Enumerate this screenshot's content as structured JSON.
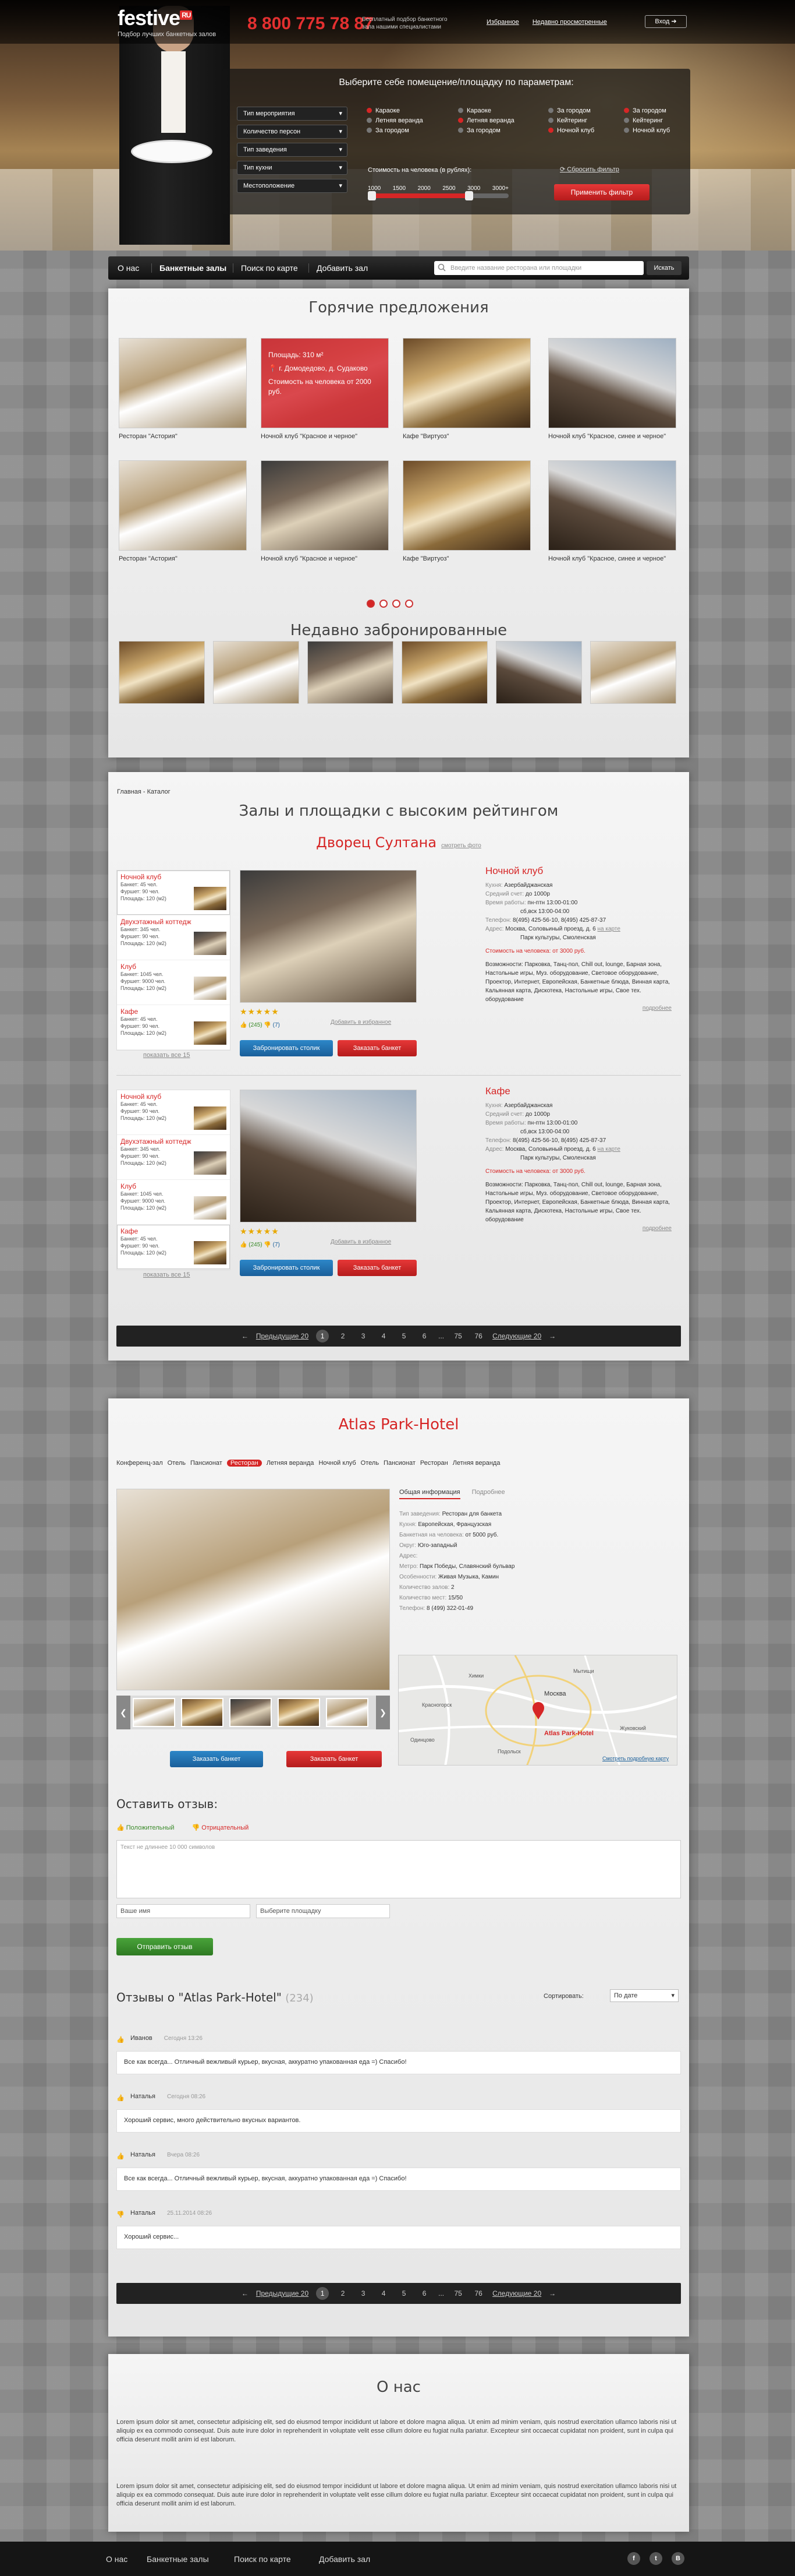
{
  "header": {
    "logo_main": "festive",
    "logo_ru": "RU",
    "tagline": "Подбор лучших банкетных залов",
    "phone": "8 800 775 78 87",
    "phone_note": "Бесплатный подбор банкетного зала нашими специалистами",
    "links": [
      "Избранное",
      "Недавно просмотренные"
    ],
    "login": "Вход"
  },
  "filter": {
    "title": "Выберите себе помещение/площадку по параметрам:",
    "selects": [
      "Тип мероприятия",
      "Количество персон",
      "Тип заведения",
      "Тип кухни",
      "Местоположение"
    ],
    "options_col1": [
      "Караоке",
      "Летняя веранда",
      "За городом"
    ],
    "options_col2": [
      "Караоке",
      "Летняя веранда",
      "За городом"
    ],
    "options_col3": [
      "За городом",
      "Кейтеринг",
      "Ночной клуб"
    ],
    "options_col4": [
      "За городом",
      "Кейтеринг",
      "Ночной клуб"
    ],
    "price_label": "Стоимость на человека (в рублях):",
    "price_scale": [
      "1000",
      "1500",
      "2000",
      "2500",
      "3000",
      "3000+"
    ],
    "price_fill": 0.72,
    "reset": "Сбросить фильтр",
    "apply": "Применить фильтр"
  },
  "nav": {
    "items": [
      "О нас",
      "Банкетные залы",
      "Поиск по карте",
      "Добавить зал"
    ],
    "search_placeholder": "Введите название ресторана или площадки",
    "search_button": "Искать"
  },
  "hot": {
    "title": "Горячие предложения",
    "promo": [
      "Площадь: 310 м²",
      "г. Домодедово, д. Судаково",
      "Стоимость на человека от 2000 руб."
    ],
    "items": [
      "Ресторан \"Астория\"",
      "Ночной клуб \"Красное и черное\"",
      "Кафе \"Виртуоз\"",
      "Ночной клуб \"Красное, синее и черное\"",
      "Ресторан \"Астория\"",
      "Ночной клуб \"Красное и черное\"",
      "Кафе \"Виртуоз\"",
      "Ночной клуб \"Красное, синее и черное\""
    ]
  },
  "recent": {
    "title": "Недавно забронированные"
  },
  "rating": {
    "crumb": "Главная - Каталог",
    "title": "Залы и площадки с высоким рейтингом",
    "venue": "Дворец Султана",
    "venue_link": "смотреть фото",
    "side_items": [
      {
        "t": "Ночной клуб",
        "l1": "Банкет: 45 чел.",
        "l2": "Фуршет: 90 чел.",
        "l3": "Площадь: 120 (м2)"
      },
      {
        "t": "Двухэтажный коттедж",
        "l1": "Банкет: 345 чел.",
        "l2": "Фуршет: 90 чел.",
        "l3": "Площадь: 120 (м2)"
      },
      {
        "t": "Клуб",
        "l1": "Банкет: 1045 чел.",
        "l2": "Фуршет: 9000 чел.",
        "l3": "Площадь: 120 (м2)"
      },
      {
        "t": "Кафе",
        "l1": "Банкет: 45 чел.",
        "l2": "Фуршет: 90 чел.",
        "l3": "Площадь: 120 (м2)"
      }
    ],
    "side_more": "показать все 15",
    "likes": "(245)",
    "dislikes": "(7)",
    "fav": "Добавить в избранное",
    "btn_table": "Забронировать столик",
    "btn_banquet": "Заказать банкет",
    "cards": [
      {
        "h": "Ночной клуб",
        "cuisine": "Азербайджанская",
        "check": "до 1000р",
        "hours1": "пн-птн 13:00-01:00",
        "hours2": "сб,вск 13:00-04:00",
        "phone": "8(495) 425-56-10, 8(495) 425-87-37",
        "addr": "Москва, Соловьиный проезд, д. 6",
        "addr2": "Парк культуры, Смоленская",
        "map": "на карте",
        "price": "Стоимость на человека: от 3000 руб.",
        "features": "Возможности: Парковка, Танц-пол, Chill out, lounge, Барная зона, Настольные игры, Муз. оборудование, Световое оборудование, Проектор, Интернет, Европейская, Банкетные блюда, Винная карта, Кальянная карта, Дискотека, Настольные игры, Свое тех. оборудование",
        "more": "подробнее"
      },
      {
        "h": "Кафе",
        "cuisine": "Азербайджанская",
        "check": "до 1000р",
        "hours1": "пн-птн 13:00-01:00",
        "hours2": "сб,вск 13:00-04:00",
        "phone": "8(495) 425-56-10, 8(495) 425-87-37",
        "addr": "Москва, Соловьиный проезд, д. 6",
        "addr2": "Парк культуры, Смоленская",
        "map": "на карте",
        "price": "Стоимость на человека: от 3000 руб.",
        "features": "Возможности: Парковка, Танц-пол, Chill out, lounge, Барная зона, Настольные игры, Муз. оборудование, Световое оборудование, Проектор, Интернет, Европейская, Банкетные блюда, Винная карта, Кальянная карта, Дискотека, Настольные игры, Свое тех. оборудование",
        "more": "подробнее"
      }
    ],
    "labels": {
      "cuisine": "Кухня:",
      "check": "Средний счет:",
      "hours": "Время работы:",
      "phone": "Телефон:",
      "addr": "Адрес:"
    }
  },
  "pager": {
    "prev": "Предыдущие 20",
    "pages": [
      "1",
      "2",
      "3",
      "4",
      "5",
      "6",
      "...",
      "75",
      "76"
    ],
    "next": "Следующие 20"
  },
  "atlas": {
    "title": "Atlas Park-Hotel",
    "tabs": [
      "Конференц-зал",
      "Отель",
      "Пансионат",
      "Ресторан",
      "Летняя веранда",
      "Ночной клуб",
      "Отель",
      "Пансионат",
      "Ресторан",
      "Летняя веранда"
    ],
    "subtabs": [
      "Общая информация",
      "Подробнее"
    ],
    "info": [
      {
        "k": "Тип заведения:",
        "v": "Ресторан для банкета"
      },
      {
        "k": "Кухня:",
        "v": "Европейская, Французская"
      },
      {
        "k": "Банкетная на человека:",
        "v": "от 5000 руб."
      },
      {
        "k": "Округ:",
        "v": "Юго-западный"
      },
      {
        "k": "Адрес:",
        "v": ""
      },
      {
        "k": "Метро:",
        "v": "Парк Победы, Славянский бульвар"
      },
      {
        "k": "Особенности:",
        "v": "Живая Музыка, Камин"
      },
      {
        "k": "Количество залов:",
        "v": "2"
      },
      {
        "k": "Количество мест:",
        "v": "15/50"
      },
      {
        "k": "Телефон:",
        "v": "8 (499) 322-01-49"
      }
    ],
    "map_label": "Atlas Park-Hotel",
    "map_cities": [
      "Москва",
      "Химки",
      "Жуковский",
      "Мытищи",
      "Красногорск",
      "Одинцово",
      "Подольск"
    ],
    "map_link": "Смотреть подробную карту",
    "btn_table": "Заказать банкет",
    "btn_banquet": "Заказать банкет",
    "review_label": "Оставить отзыв:",
    "pos": "Положительный",
    "neg": "Отрицательный",
    "textarea": "Текст не длиннее 10 000 символов",
    "name_ph": "Ваше имя",
    "hall_ph": "Выберите площадку",
    "send": "Отправить отзыв",
    "reviews_title": "Отзывы о \"Atlas Park-Hotel\"",
    "reviews_count": "(234)",
    "sort_label": "Сортировать:",
    "sort_value": "По дате",
    "reviews": [
      {
        "name": "Иванов",
        "date": "Сегодня 13:26",
        "text": "Все как всегда... Отличный вежливый курьер, вкусная, аккуратно упакованная еда =) Спасибо!",
        "pos": true
      },
      {
        "name": "Наталья",
        "date": "Сегодня 08:26",
        "text": "Хороший сервис, много действительно вкусных вариантов.",
        "pos": true
      },
      {
        "name": "Наталья",
        "date": "Вчера 08:26",
        "text": "Все как всегда... Отличный вежливый курьер, вкусная, аккуратно упакованная еда =) Спасибо!",
        "pos": true
      },
      {
        "name": "Наталья",
        "date": "25.11.2014 08:26",
        "text": "Хороший сервис...",
        "pos": false
      }
    ]
  },
  "about": {
    "title": "О нас",
    "p1": "Lorem ipsum dolor sit amet, consectetur adipisicing elit, sed do eiusmod tempor incididunt ut labore et dolore magna aliqua. Ut enim ad minim veniam, quis nostrud exercitation ullamco laboris nisi ut aliquip ex ea commodo consequat. Duis aute irure dolor in reprehenderit in voluptate velit esse cillum dolore eu fugiat nulla pariatur. Excepteur sint occaecat cupidatat non proident, sunt in culpa qui officia deserunt mollit anim id est laborum.",
    "p2": "Lorem ipsum dolor sit amet, consectetur adipisicing elit, sed do eiusmod tempor incididunt ut labore et dolore magna aliqua. Ut enim ad minim veniam, quis nostrud exercitation ullamco laboris nisi ut aliquip ex ea commodo consequat. Duis aute irure dolor in reprehenderit in voluptate velit esse cillum dolore eu fugiat nulla pariatur. Excepteur sint occaecat cupidatat non proident, sunt in culpa qui officia deserunt mollit anim id est laborum."
  },
  "footer": {
    "items": [
      "О нас",
      "Банкетные залы",
      "Поиск по карте",
      "Добавить зал"
    ],
    "social": [
      "f",
      "t",
      "В"
    ]
  },
  "colors": {
    "accent": "#d62626",
    "blue": "#1a5f9a",
    "green": "#3a8a2a"
  }
}
